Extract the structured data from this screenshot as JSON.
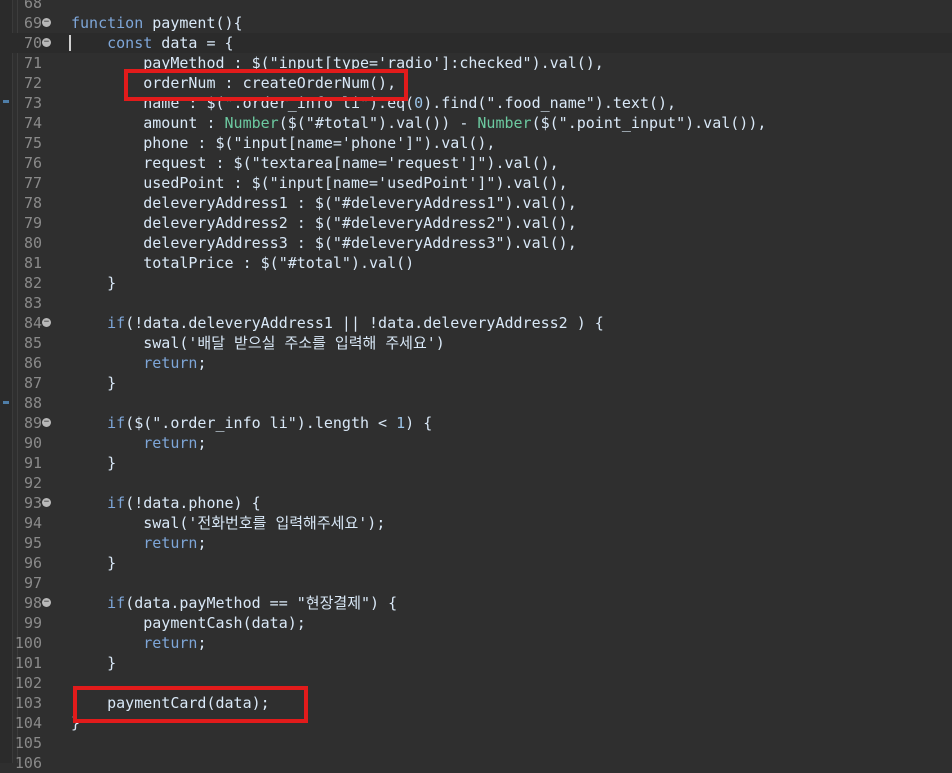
{
  "editor": {
    "lines": [
      {
        "n": "68",
        "fold": false,
        "t": ""
      },
      {
        "n": "69",
        "fold": true,
        "t": "function payment(){"
      },
      {
        "n": "70",
        "fold": true,
        "t": "    const data = {"
      },
      {
        "n": "71",
        "fold": false,
        "t": "        payMethod : $(\"input[type='radio']:checked\").val(),"
      },
      {
        "n": "72",
        "fold": false,
        "t": "        orderNum : createOrderNum(),"
      },
      {
        "n": "73",
        "fold": false,
        "t": "        name : $(\".order_info li\").eq(0).find(\".food_name\").text(),"
      },
      {
        "n": "74",
        "fold": false,
        "t": "        amount : Number($(\"#total\").val()) - Number($(\".point_input\").val()),"
      },
      {
        "n": "75",
        "fold": false,
        "t": "        phone : $(\"input[name='phone']\").val(),"
      },
      {
        "n": "76",
        "fold": false,
        "t": "        request : $(\"textarea[name='request']\").val(),"
      },
      {
        "n": "77",
        "fold": false,
        "t": "        usedPoint : $(\"input[name='usedPoint']\").val(),"
      },
      {
        "n": "78",
        "fold": false,
        "t": "        deleveryAddress1 : $(\"#deleveryAddress1\").val(),"
      },
      {
        "n": "79",
        "fold": false,
        "t": "        deleveryAddress2 : $(\"#deleveryAddress2\").val(),"
      },
      {
        "n": "80",
        "fold": false,
        "t": "        deleveryAddress3 : $(\"#deleveryAddress3\").val(),"
      },
      {
        "n": "81",
        "fold": false,
        "t": "        totalPrice : $(\"#total\").val()"
      },
      {
        "n": "82",
        "fold": false,
        "t": "    }"
      },
      {
        "n": "83",
        "fold": false,
        "t": ""
      },
      {
        "n": "84",
        "fold": true,
        "t": "    if(!data.deleveryAddress1 || !data.deleveryAddress2 ) {"
      },
      {
        "n": "85",
        "fold": false,
        "t": "        swal('배달 받으실 주소를 입력해 주세요')"
      },
      {
        "n": "86",
        "fold": false,
        "t": "        return;"
      },
      {
        "n": "87",
        "fold": false,
        "t": "    }"
      },
      {
        "n": "88",
        "fold": false,
        "t": ""
      },
      {
        "n": "89",
        "fold": true,
        "t": "    if($(\".order_info li\").length < 1) {"
      },
      {
        "n": "90",
        "fold": false,
        "t": "        return;"
      },
      {
        "n": "91",
        "fold": false,
        "t": "    }"
      },
      {
        "n": "92",
        "fold": false,
        "t": ""
      },
      {
        "n": "93",
        "fold": true,
        "t": "    if(!data.phone) {"
      },
      {
        "n": "94",
        "fold": false,
        "t": "        swal('전화번호를 입력해주세요');"
      },
      {
        "n": "95",
        "fold": false,
        "t": "        return;"
      },
      {
        "n": "96",
        "fold": false,
        "t": "    }"
      },
      {
        "n": "97",
        "fold": false,
        "t": ""
      },
      {
        "n": "98",
        "fold": true,
        "t": "    if(data.payMethod == \"현장결제\") {"
      },
      {
        "n": "99",
        "fold": false,
        "t": "        paymentCash(data);"
      },
      {
        "n": "100",
        "fold": false,
        "t": "        return;"
      },
      {
        "n": "101",
        "fold": false,
        "t": "    }"
      },
      {
        "n": "102",
        "fold": false,
        "t": ""
      },
      {
        "n": "103",
        "fold": false,
        "t": "    paymentCard(data);"
      },
      {
        "n": "104",
        "fold": false,
        "t": "}"
      },
      {
        "n": "105",
        "fold": false,
        "t": ""
      },
      {
        "n": "106",
        "fold": false,
        "t": ""
      }
    ]
  },
  "colors": {
    "background": "#2f2f2f",
    "keyword": "#7ea6d8",
    "highlight_box": "#e21b1b"
  }
}
